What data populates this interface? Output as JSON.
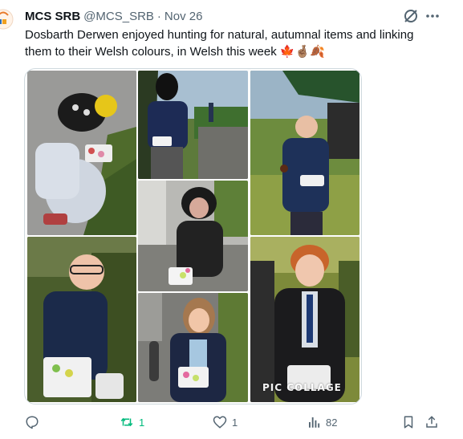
{
  "post": {
    "author_name": "MCS SRB",
    "author_handle": "@MCS_SRB",
    "separator": "·",
    "date": "Nov 26",
    "text": "Dosbarth Derwen enjoyed hunting for natural, autumnal items and linking them to their Welsh colours, in Welsh this week 🍁🤞🏽🍂"
  },
  "media": {
    "watermark": "PIC COLLAGE",
    "photo_count": 7
  },
  "actions": {
    "replies": "",
    "retweets": "1",
    "likes": "1",
    "views": "82"
  },
  "colors": {
    "retweet_active": "#00ba7c",
    "secondary_text": "#536471",
    "border": "#cfd9de"
  },
  "icons": [
    "reply-icon",
    "retweet-icon",
    "like-icon",
    "views-icon",
    "bookmark-icon",
    "share-icon",
    "grok-icon",
    "more-icon"
  ]
}
